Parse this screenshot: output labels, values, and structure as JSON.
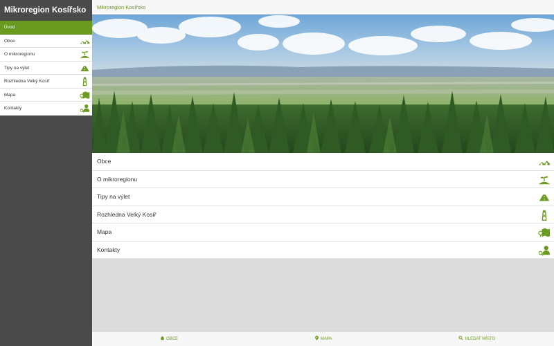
{
  "app_title": "Mikroregion Kosířsko",
  "header": {
    "title": "Mikroregion Kosířsko"
  },
  "colors": {
    "accent": "#6a9a1f",
    "sidebar_bg": "#4a4a4a",
    "content_bg": "#dcdcdc"
  },
  "sidebar": {
    "items": [
      {
        "label": "Úvod",
        "icon": "none",
        "active": true
      },
      {
        "label": "Obce",
        "icon": "village-houses-icon"
      },
      {
        "label": "O mikroregionu",
        "icon": "plant-hill-icon"
      },
      {
        "label": "Tipy na výlet",
        "icon": "road-icon"
      },
      {
        "label": "Rozhledna Velký Kosíř",
        "icon": "lookout-tower-icon"
      },
      {
        "label": "Mapa",
        "icon": "map-pin-icon"
      },
      {
        "label": "Kontakty",
        "icon": "contact-person-icon"
      }
    ]
  },
  "banner": {
    "alt": "landscape-forest-photo"
  },
  "menu": {
    "items": [
      {
        "label": "Obce",
        "icon": "village-houses-icon"
      },
      {
        "label": "O mikroregionu",
        "icon": "plant-hill-icon"
      },
      {
        "label": "Tipy na výlet",
        "icon": "road-icon"
      },
      {
        "label": "Rozhledna Velký Kosíř",
        "icon": "lookout-tower-icon"
      },
      {
        "label": "Mapa",
        "icon": "map-pin-icon"
      },
      {
        "label": "Kontakty",
        "icon": "contact-person-icon"
      }
    ]
  },
  "bottom_nav": {
    "obce": "OBCE",
    "mapa": "MAPA",
    "hledat": "HLEDAT MÍSTO"
  }
}
